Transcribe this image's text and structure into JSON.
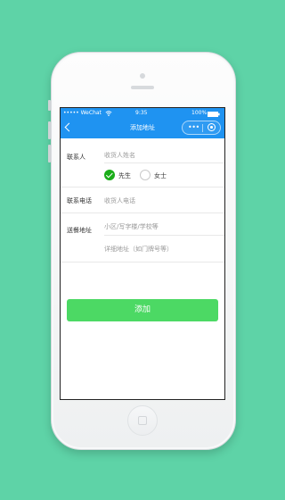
{
  "status_bar": {
    "carrier": "••••• WeChat",
    "wifi_icon": "wifi-icon",
    "time": "9:35",
    "battery_percent": "100%"
  },
  "nav": {
    "title": "添加地址",
    "more": "•••"
  },
  "form": {
    "contact_label": "联系人",
    "name_placeholder": "收货人姓名",
    "gender_options": [
      "先生",
      "女士"
    ],
    "gender_selected": "先生",
    "phone_label": "联系电话",
    "phone_placeholder": "收货人电话",
    "address_label": "送餐地址",
    "address_placeholder": "小区/写字楼/学校等",
    "detail_placeholder": "详细地址（如门牌号等）",
    "submit_label": "添加"
  },
  "colors": {
    "background": "#5ed3a7",
    "nav": "#1f93f1",
    "submit": "#4cd964",
    "radio_selected": "#1aad19"
  }
}
